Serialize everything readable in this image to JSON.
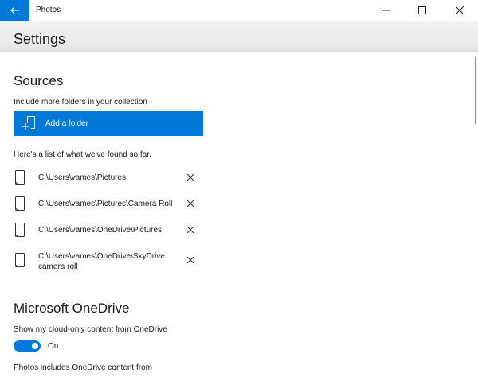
{
  "window": {
    "app_title": "Photos",
    "back_icon": "arrow-left-icon",
    "minimize_icon": "minimize-icon",
    "maximize_icon": "maximize-icon",
    "close_icon": "close-icon"
  },
  "header": {
    "title": "Settings"
  },
  "sources": {
    "heading": "Sources",
    "include_text": "Include more folders in your collection",
    "add_folder_label": "Add a folder",
    "found_text": "Here's a list of what we've found so far.",
    "folders": [
      {
        "path": "C:\\Users\\vames\\Pictures"
      },
      {
        "path": "C:\\Users\\vames\\Pictures\\Camera Roll"
      },
      {
        "path": "C:\\Users\\vames\\OneDrive\\Pictures"
      },
      {
        "path": "C:\\Users\\vames\\OneDrive\\SkyDrive camera roll"
      }
    ]
  },
  "onedrive": {
    "heading": "Microsoft OneDrive",
    "cloud_content_label": "Show my cloud-only content from OneDrive",
    "toggle_state": "On",
    "toggle_on": true,
    "includes_text": "Photos includes OneDrive content from"
  },
  "colors": {
    "accent": "#0078d7"
  }
}
